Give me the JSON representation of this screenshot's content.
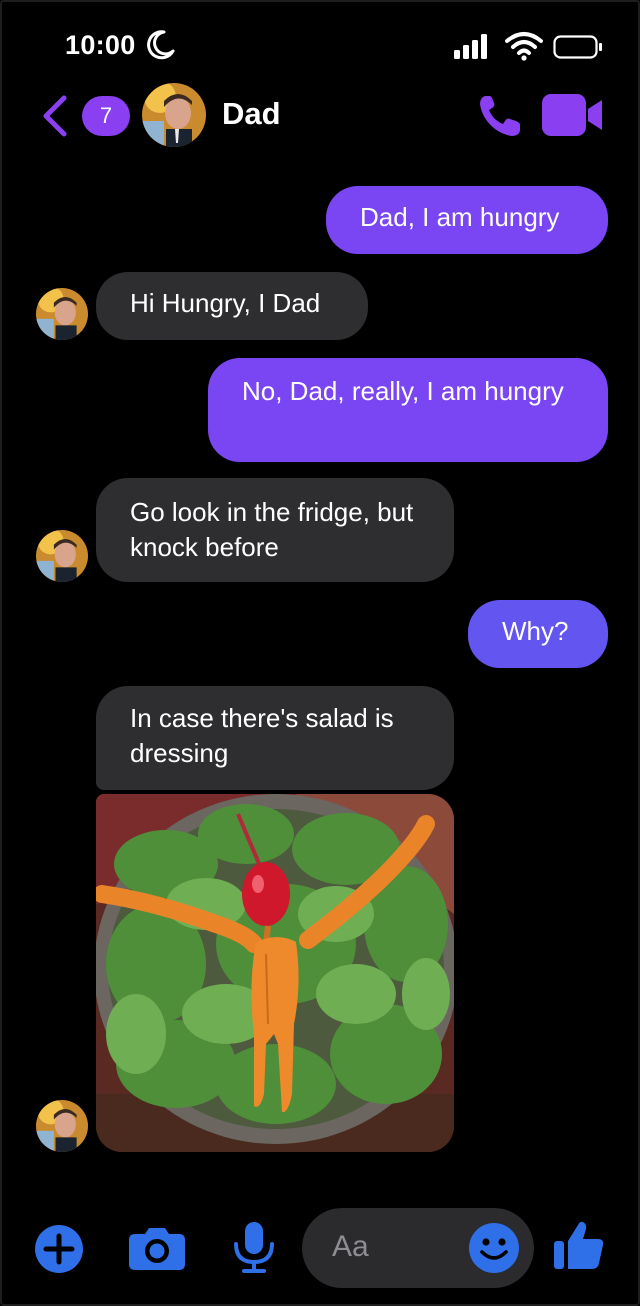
{
  "status_bar": {
    "time": "10:00"
  },
  "header": {
    "unread_count": "7",
    "contact_name": "Dad"
  },
  "messages": [
    {
      "from": "me",
      "text": "Dad, I am hungry"
    },
    {
      "from": "dad",
      "text": "Hi Hungry, I Dad"
    },
    {
      "from": "me",
      "text": "No, Dad, really, I am hungry"
    },
    {
      "from": "dad",
      "text": "Go look in the fridge, but knock before"
    },
    {
      "from": "me",
      "text": "Why?"
    },
    {
      "from": "dad",
      "text": "In case there's salad is dressing"
    },
    {
      "from": "dad",
      "type": "image",
      "description_icon": "salad-photo"
    }
  ],
  "composer": {
    "placeholder": "Aa"
  },
  "colors": {
    "accent": "#8a3ff0",
    "outgoing_bubble": "#7a45f2",
    "incoming_bubble": "#2e2e30",
    "toolbar_blue": "#2f6fe8"
  },
  "icons": [
    "moon-icon",
    "signal-icon",
    "wifi-icon",
    "battery-icon",
    "back-chevron-icon",
    "phone-icon",
    "video-camera-icon",
    "plus-icon",
    "camera-icon",
    "microphone-icon",
    "smiley-icon",
    "thumbs-up-icon"
  ]
}
